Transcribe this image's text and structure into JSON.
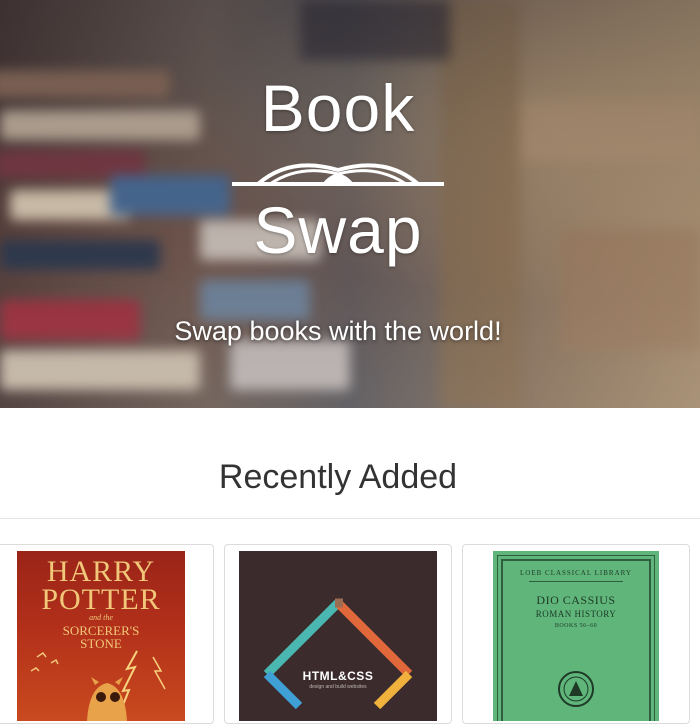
{
  "hero": {
    "logo_word1": "Book",
    "logo_word2": "Swap",
    "tagline": "Swap books with the world!"
  },
  "recent": {
    "title": "Recently Added",
    "books": [
      {
        "cover_lines": [
          "HARRY",
          "POTTER",
          "and the",
          "SORCERER'S",
          "STONE"
        ],
        "cover_color": "#b2301a"
      },
      {
        "cover_lines": [
          "HTML&CSS",
          "design and build websites"
        ],
        "cover_color": "#3b2b2d"
      },
      {
        "cover_lines": [
          "LOEB CLASSICAL LIBRARY",
          "DIO CASSIUS",
          "ROMAN HISTORY",
          "BOOKS 56–60"
        ],
        "cover_color": "#5fb57a"
      }
    ]
  }
}
